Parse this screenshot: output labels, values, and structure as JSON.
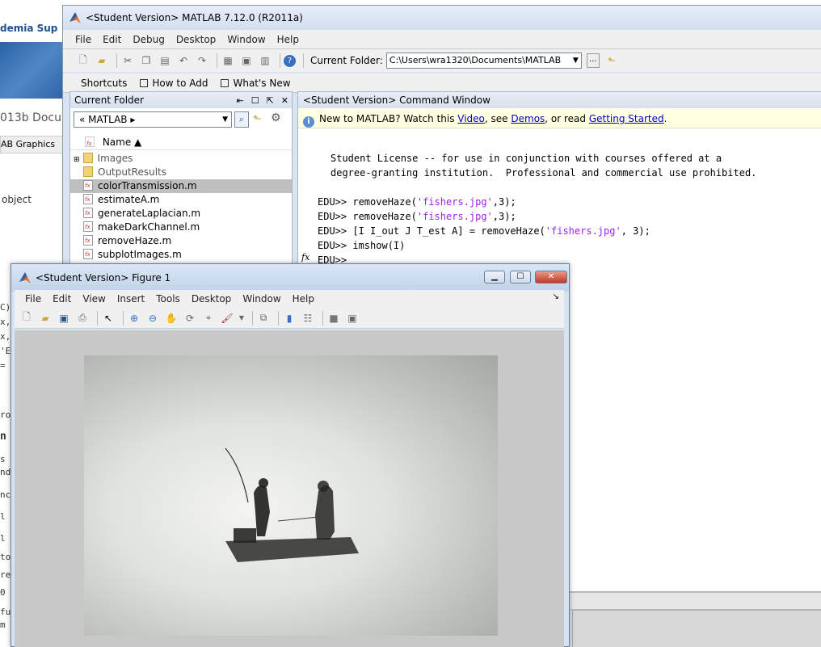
{
  "background_page": {
    "nav": "demia    Sup",
    "doc_title": "013b Docum",
    "crumbs": "AB  Graphics",
    "obj_text": "object",
    "code_lines": [
      "C)",
      "x,",
      "x,",
      "'E",
      " ="
    ],
    "frag_lines": [
      "rop",
      "n",
      "s a",
      "ndi",
      "nc",
      "l fu",
      "l Y",
      "to",
      "rev",
      "0",
      "fu",
      "m"
    ]
  },
  "main_window": {
    "title": "<Student Version> MATLAB  7.12.0 (R2011a)",
    "menu": [
      "File",
      "Edit",
      "Debug",
      "Desktop",
      "Window",
      "Help"
    ],
    "current_folder_label": "Current Folder:",
    "current_folder_path": "C:\\Users\\wra1320\\Documents\\MATLAB",
    "browse_label": "...",
    "shortcuts": [
      "Shortcuts",
      "How to Add",
      "What's New"
    ]
  },
  "folder_pane": {
    "title": "Current Folder",
    "nav_path": "«  MATLAB  ▸",
    "column_name": "Name ▲",
    "items": [
      {
        "name": "Images",
        "type": "folder"
      },
      {
        "name": "OutputResults",
        "type": "folder"
      },
      {
        "name": "colorTransmission.m",
        "type": "file",
        "selected": true
      },
      {
        "name": "estimateA.m",
        "type": "file"
      },
      {
        "name": "generateLaplacian.m",
        "type": "file"
      },
      {
        "name": "makeDarkChannel.m",
        "type": "file"
      },
      {
        "name": "removeHaze.m",
        "type": "file"
      },
      {
        "name": "subplotImages.m",
        "type": "file"
      }
    ]
  },
  "command_window": {
    "title": "<Student Version> Command Window",
    "info_prefix": "New to MATLAB? Watch this ",
    "info_video": "Video",
    "info_mid": ", see ",
    "info_demos": "Demos",
    "info_or": ", or read ",
    "info_getting_started": "Getting Started",
    "info_end": ".",
    "license_line1": "Student License -- for use in conjunction with courses offered at a",
    "license_line2": "degree-granting institution.  Professional and commercial use prohibited.",
    "prompt": "EDU>> ",
    "cmd1_a": "removeHaze(",
    "cmd1_str": "'fishers.jpg'",
    "cmd1_b": ",3);",
    "cmd2_a": "removeHaze(",
    "cmd2_str": "'fishers.jpg'",
    "cmd2_b": ",3);",
    "cmd3_a": "[I I_out J T_est A] = removeHaze(",
    "cmd3_str": "'fishers.jpg'",
    "cmd3_b": ", 3);",
    "cmd4": "imshow(I)",
    "prompt_empty": "EDU>>",
    "fx_label": "fx"
  },
  "figure_window": {
    "title": "<Student Version> Figure 1",
    "menu": [
      "File",
      "Edit",
      "View",
      "Insert",
      "Tools",
      "Desktop",
      "Window",
      "Help"
    ],
    "dock_arrow": "↘"
  },
  "icons": [
    "matlab-logo-icon",
    "new-file-icon",
    "open-icon",
    "cut-icon",
    "copy-icon",
    "paste-icon",
    "undo-icon",
    "redo-icon",
    "help-icon",
    "folder-up-icon",
    "search-icon",
    "gear-icon",
    "zoom-in-icon",
    "zoom-out-icon",
    "pan-icon",
    "rotate-icon",
    "data-cursor-icon",
    "brush-icon",
    "print-icon",
    "save-icon",
    "pointer-icon",
    "colorbar-icon",
    "legend-icon"
  ]
}
